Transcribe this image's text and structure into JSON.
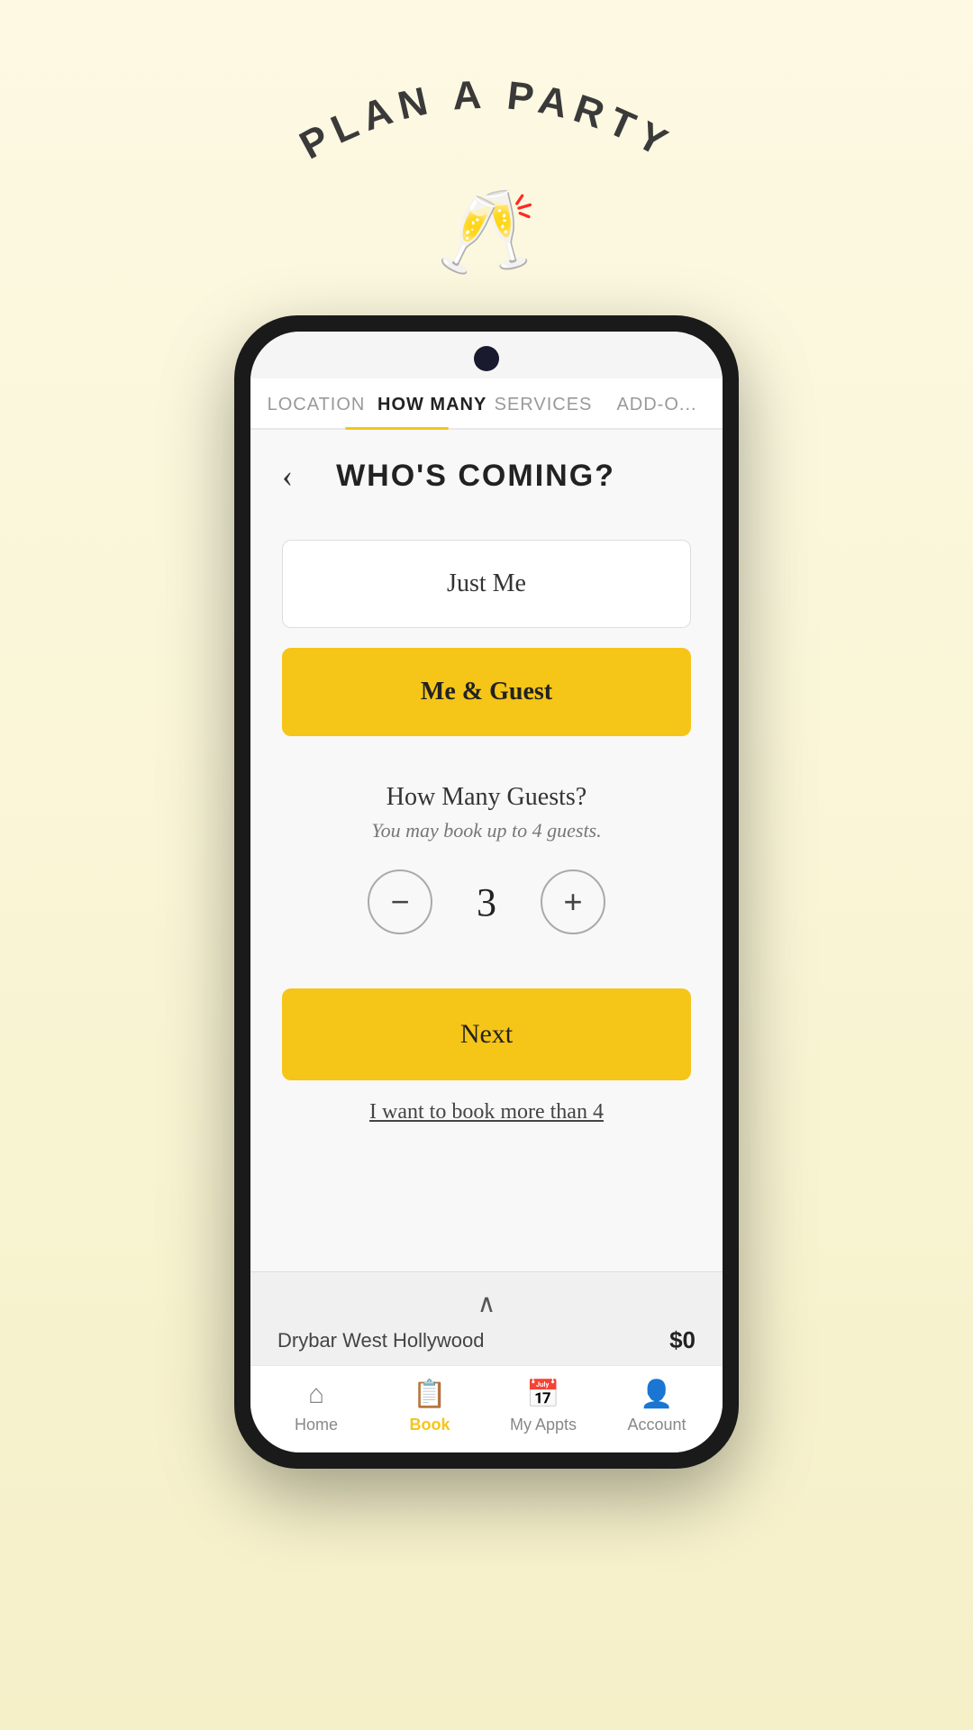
{
  "app": {
    "title": "PLAN A PARTY",
    "champagne_emoji": "🥂"
  },
  "tabs": {
    "items": [
      {
        "id": "location",
        "label": "LOCATION",
        "active": false
      },
      {
        "id": "how-many",
        "label": "HOW MANY",
        "active": true
      },
      {
        "id": "services",
        "label": "SERVICES",
        "active": false
      },
      {
        "id": "add-ons",
        "label": "ADD-O...",
        "active": false
      }
    ]
  },
  "page": {
    "title": "WHO'S COMING?",
    "back_label": "‹"
  },
  "options": {
    "just_me": {
      "label": "Just Me",
      "selected": false
    },
    "me_and_guest": {
      "label": "Me & Guest",
      "selected": true
    }
  },
  "guests": {
    "title": "How Many Guests?",
    "subtitle": "You may book up to 4 guests.",
    "count": "3",
    "decrement_label": "−",
    "increment_label": "+"
  },
  "actions": {
    "next_label": "Next",
    "more_than_four_label": "I want to book more than 4"
  },
  "bottom_bar": {
    "chevron": "∧",
    "location": "Drybar West Hollywood",
    "price": "$0"
  },
  "nav": {
    "items": [
      {
        "id": "home",
        "label": "Home",
        "icon": "⌂",
        "active": false
      },
      {
        "id": "book",
        "label": "Book",
        "icon": "📋",
        "active": true
      },
      {
        "id": "my-appts",
        "label": "My Appts",
        "icon": "📅",
        "active": false
      },
      {
        "id": "account",
        "label": "Account",
        "icon": "👤",
        "active": false
      }
    ]
  }
}
